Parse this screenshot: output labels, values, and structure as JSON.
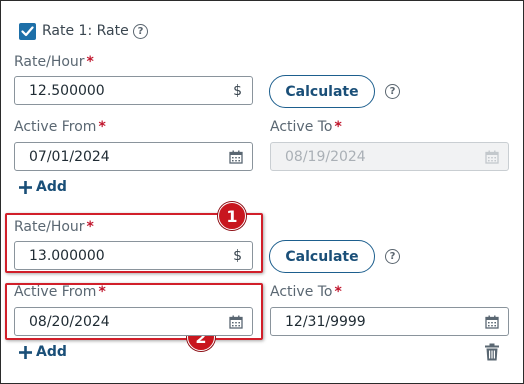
{
  "rate": {
    "title": "Rate 1: Rate",
    "checked": true
  },
  "block1": {
    "rate_label": "Rate/Hour",
    "rate_value": "12.500000",
    "currency": "$",
    "calculate": "Calculate",
    "active_from_label": "Active From",
    "active_from_value": "07/01/2024",
    "active_to_label": "Active To",
    "active_to_value": "08/19/2024",
    "add": "Add"
  },
  "block2": {
    "rate_label": "Rate/Hour",
    "rate_value": "13.000000",
    "currency": "$",
    "calculate": "Calculate",
    "active_from_label": "Active From",
    "active_from_value": "08/20/2024",
    "active_to_label": "Active To",
    "active_to_value": "12/31/9999",
    "add": "Add"
  },
  "callouts": [
    "1",
    "2"
  ],
  "required_marker": "*",
  "help_glyph": "?",
  "colors": {
    "accent": "#1d6fa8",
    "button_text": "#1a4f78",
    "required": "#c0152c",
    "highlight": "#d11f2a"
  }
}
